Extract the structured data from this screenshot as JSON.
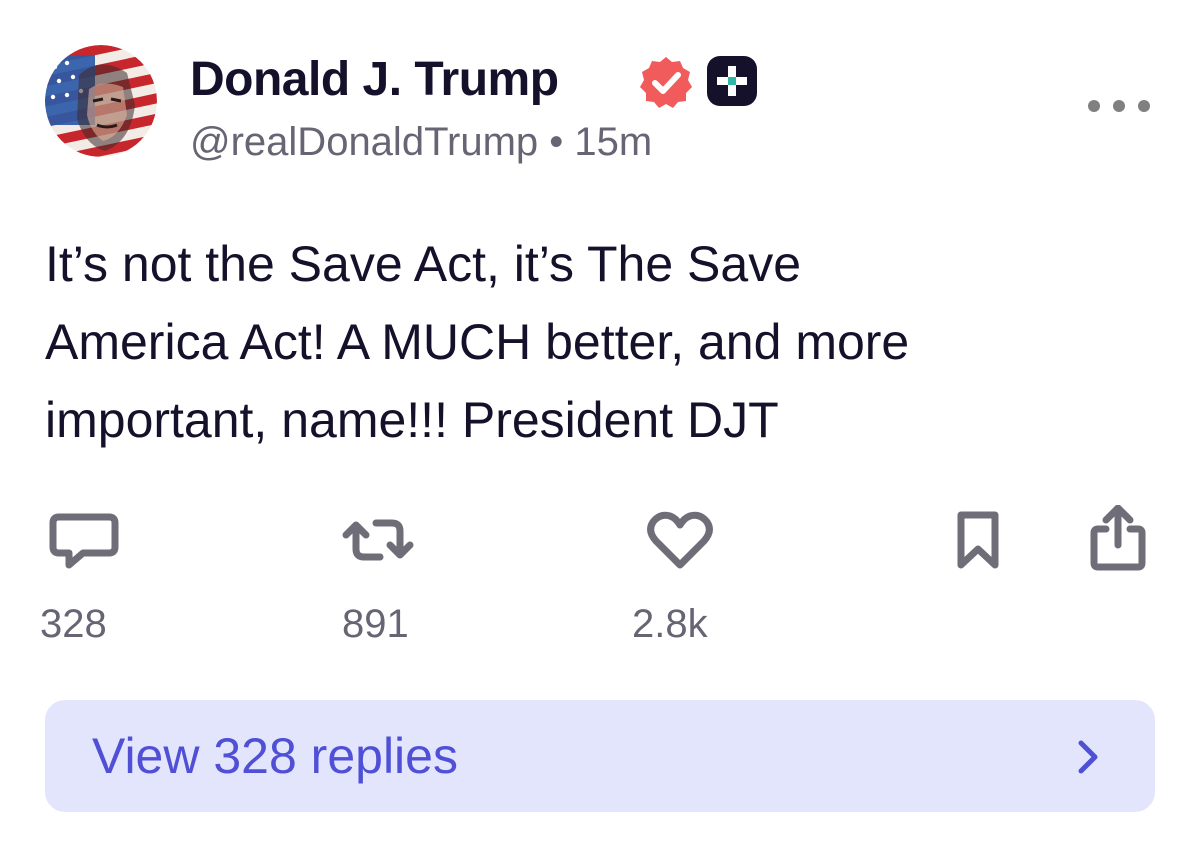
{
  "post": {
    "author": {
      "display_name": "Donald J. Trump",
      "handle": "@realDonaldTrump",
      "separator": "•",
      "time_ago": "15m",
      "verified_icon": "verified-badge-icon",
      "verified_color": "#f25b5b",
      "plus_icon": "plus-badge-icon"
    },
    "more_icon": "more-options-icon",
    "body_lines": [
      "It’s not the Save Act, it’s The Save",
      "America Act! A MUCH better, and more",
      "important, name!!! President DJT"
    ],
    "actions": {
      "reply": {
        "icon": "reply-icon",
        "count": "328"
      },
      "repost": {
        "icon": "repost-icon",
        "count": "891"
      },
      "like": {
        "icon": "heart-icon",
        "count": "2.8k"
      },
      "bookmark": {
        "icon": "bookmark-icon"
      },
      "share": {
        "icon": "share-icon"
      }
    },
    "replies_button": {
      "label": "View 328 replies",
      "icon": "chevron-right-icon"
    }
  },
  "colors": {
    "text": "#15112b",
    "muted": "#676473",
    "icon": "#6f6d78",
    "replies_bg": "#e3e5fc",
    "replies_text": "#4f50d6"
  }
}
